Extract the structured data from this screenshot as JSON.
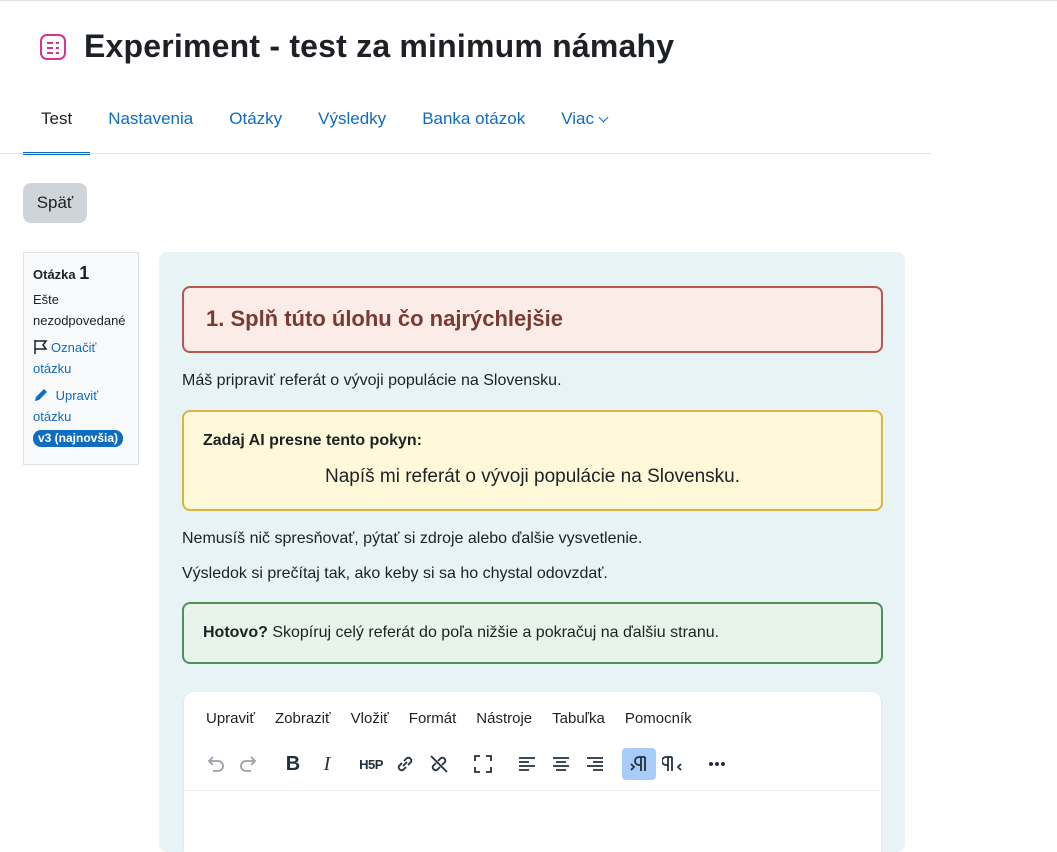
{
  "page": {
    "title": "Experiment - test za minimum námahy"
  },
  "tabs": [
    {
      "label": "Test",
      "active": true
    },
    {
      "label": "Nastavenia"
    },
    {
      "label": "Otázky"
    },
    {
      "label": "Výsledky"
    },
    {
      "label": "Banka otázok"
    },
    {
      "label": "Viac"
    }
  ],
  "back_button": "Späť",
  "question_info": {
    "label": "Otázka",
    "number": "1",
    "state_line1": "Ešte",
    "state_line2": "nezodpovedané",
    "flag_line1": "Označiť",
    "flag_line2": "otázku",
    "edit_line1": "Upraviť",
    "edit_line2": "otázku",
    "version_badge": "v3 (najnovšia)"
  },
  "content": {
    "heading": "1. Splň túto úlohu čo najrýchlejšie",
    "intro": "Máš pripraviť referát o vývoji populácie na Slovensku.",
    "prompt_label": "Zadaj AI presne tento pokyn:",
    "prompt_text": "Napíš mi referát o vývoji populácie na Slovensku.",
    "note1": "Nemusíš nič spresňovať, pýtať si zdroje alebo ďalšie vysvetlenie.",
    "note2": "Výsledok si prečítaj tak, ako keby si sa ho chystal odovzdať.",
    "done_bold": "Hotovo?",
    "done_text": " Skopíruj celý referát do poľa nižšie a pokračuj na ďalšiu stranu."
  },
  "editor": {
    "menu": [
      "Upraviť",
      "Zobraziť",
      "Vložiť",
      "Formát",
      "Nástroje",
      "Tabuľka",
      "Pomocník"
    ],
    "h5p_label": "H5P",
    "toolbar_icons": [
      "undo-icon",
      "redo-icon",
      "bold-icon",
      "italic-icon",
      "h5p-icon",
      "link-icon",
      "unlink-icon",
      "fullscreen-icon",
      "align-left-icon",
      "align-center-icon",
      "align-right-icon",
      "ltr-icon",
      "rtl-icon",
      "more-icon"
    ]
  },
  "colors": {
    "accent": "#0f6cbf",
    "panel_bg": "#e7f3f5",
    "heading_box": "#fbece8",
    "prompt_box": "#fff8d9",
    "done_box": "#e8f4ea"
  }
}
